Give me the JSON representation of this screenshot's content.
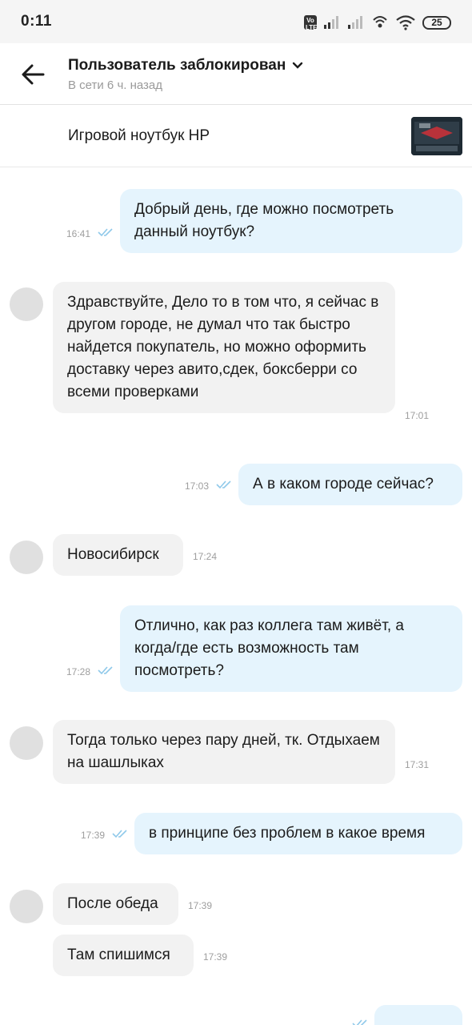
{
  "status_bar": {
    "time": "0:11",
    "volte": "Vo LTE",
    "battery": "25"
  },
  "header": {
    "title": "Пользователь заблокирован",
    "subtitle": "В сети 6 ч. назад"
  },
  "item": {
    "title": "Игровой ноутбук HP"
  },
  "messages": [
    {
      "dir": "out",
      "text": "Добрый день, где можно посмотреть данный ноутбук?",
      "time": "16:41"
    },
    {
      "dir": "in",
      "text": "Здравствуйте, Дело то в том что, я сейчас в другом городе, не думал что так быстро найдется покупатель, но можно оформить доставку через авито,сдек, боксберри со всеми проверками",
      "time": "17:01"
    },
    {
      "dir": "out",
      "text": "А в каком городе сейчас?",
      "time": "17:03"
    },
    {
      "dir": "in",
      "text": "Новосибирск",
      "time": "17:24"
    },
    {
      "dir": "out",
      "text": "Отлично, как раз коллега там живёт, а когда/где есть возможность там посмотреть?",
      "time": "17:28"
    },
    {
      "dir": "in",
      "text": "Тогда только через пару дней, тк. Отдыхаем на шашлыках",
      "time": "17:31"
    },
    {
      "dir": "out",
      "text": "в принципе без проблем в какое время",
      "time": "17:39"
    },
    {
      "dir": "in",
      "text": "После обеда",
      "time": "17:39"
    },
    {
      "dir": "in",
      "text": "Там спишимся",
      "time": "17:39"
    }
  ]
}
